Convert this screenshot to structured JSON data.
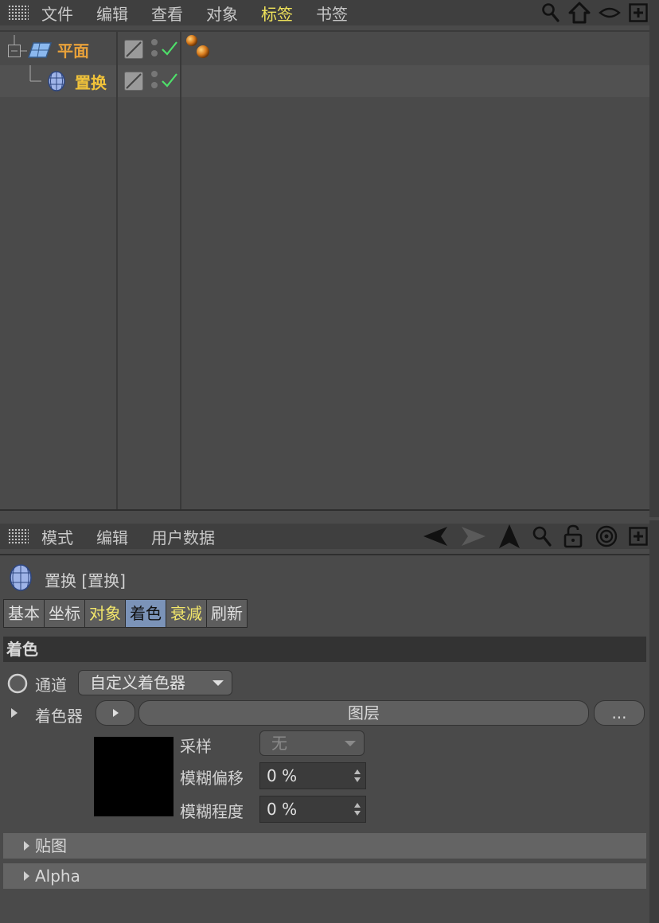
{
  "object_manager": {
    "menu": [
      "文件",
      "编辑",
      "查看",
      "对象",
      "标签",
      "书签"
    ],
    "active_menu": "标签",
    "objects": [
      {
        "name": "平面",
        "color": "#e8a13a"
      },
      {
        "name": "置换",
        "color": "#f0c23a"
      }
    ]
  },
  "attribute_manager": {
    "menu": [
      "模式",
      "编辑",
      "用户数据"
    ],
    "title": "置换 [置换]",
    "tabs": [
      "基本",
      "坐标",
      "对象",
      "着色",
      "衰减",
      "刷新"
    ],
    "active_tab": "着色",
    "section_title": "着色",
    "channel_label": "通道",
    "channel_value": "自定义着色器",
    "shader_label": "着色器",
    "shader_value": "图层",
    "more_button": "...",
    "sampling_label": "采样",
    "sampling_value": "无",
    "blur_offset_label": "模糊偏移",
    "blur_offset_value": "0 %",
    "blur_scale_label": "模糊程度",
    "blur_scale_value": "0 %",
    "collapsed_sections": [
      "贴图",
      "Alpha"
    ]
  },
  "colors": {
    "accent_yellow": "#f0e35a",
    "active_tab": "#7b93b8",
    "check_green": "#4ee06a"
  }
}
